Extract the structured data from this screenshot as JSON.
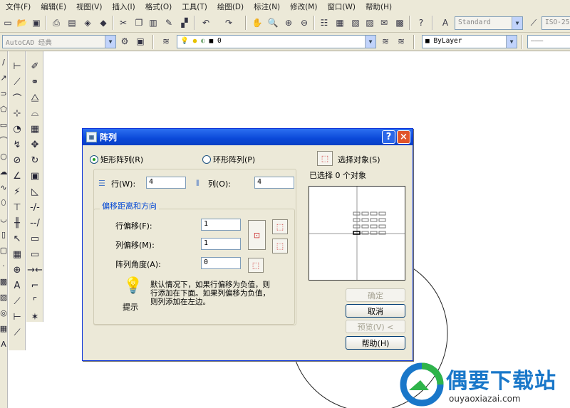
{
  "menu": [
    "文件(F)",
    "编辑(E)",
    "视图(V)",
    "插入(I)",
    "格式(O)",
    "工具(T)",
    "绘图(D)",
    "标注(N)",
    "修改(M)",
    "窗口(W)",
    "帮助(H)"
  ],
  "toolbar": {
    "text_style": "Standard",
    "dim_style": "ISO-25",
    "workspace": "AutoCAD 经典",
    "layer": "0",
    "color": "ByLayer"
  },
  "dialog": {
    "title": "阵列",
    "help_glyph": "?",
    "close_glyph": "×",
    "rect_array": "矩形阵列(R)",
    "polar_array": "环形阵列(P)",
    "select_objects": "选择对象(S)",
    "selected_count": "已选择 0 个对象",
    "rows_label": "行(W):",
    "rows_value": "4",
    "cols_label": "列(O):",
    "cols_value": "4",
    "offset_group": "偏移距离和方向",
    "row_offset_label": "行偏移(F):",
    "row_offset_value": "1",
    "col_offset_label": "列偏移(M):",
    "col_offset_value": "1",
    "angle_label": "阵列角度(A):",
    "angle_value": "0",
    "tip_text_1": "默认情况下，如果行偏移为负值，则",
    "tip_text_2": "行添加在下面。如果列偏移为负值，",
    "tip_text_3": "则列添加在左边。",
    "tip_label": "提示",
    "ok": "确定",
    "cancel": "取消",
    "preview": "预览(V) <",
    "help": "帮助(H)"
  },
  "watermark": {
    "title": "偶要下载站",
    "subtitle": "ouyaoxiazai.com"
  },
  "colors": {
    "titlebar": "#0a48d8",
    "dialog_bg": "#ece9d8",
    "toolbar_bg": "#ece9d8",
    "watermark_blue": "#1977c9"
  }
}
